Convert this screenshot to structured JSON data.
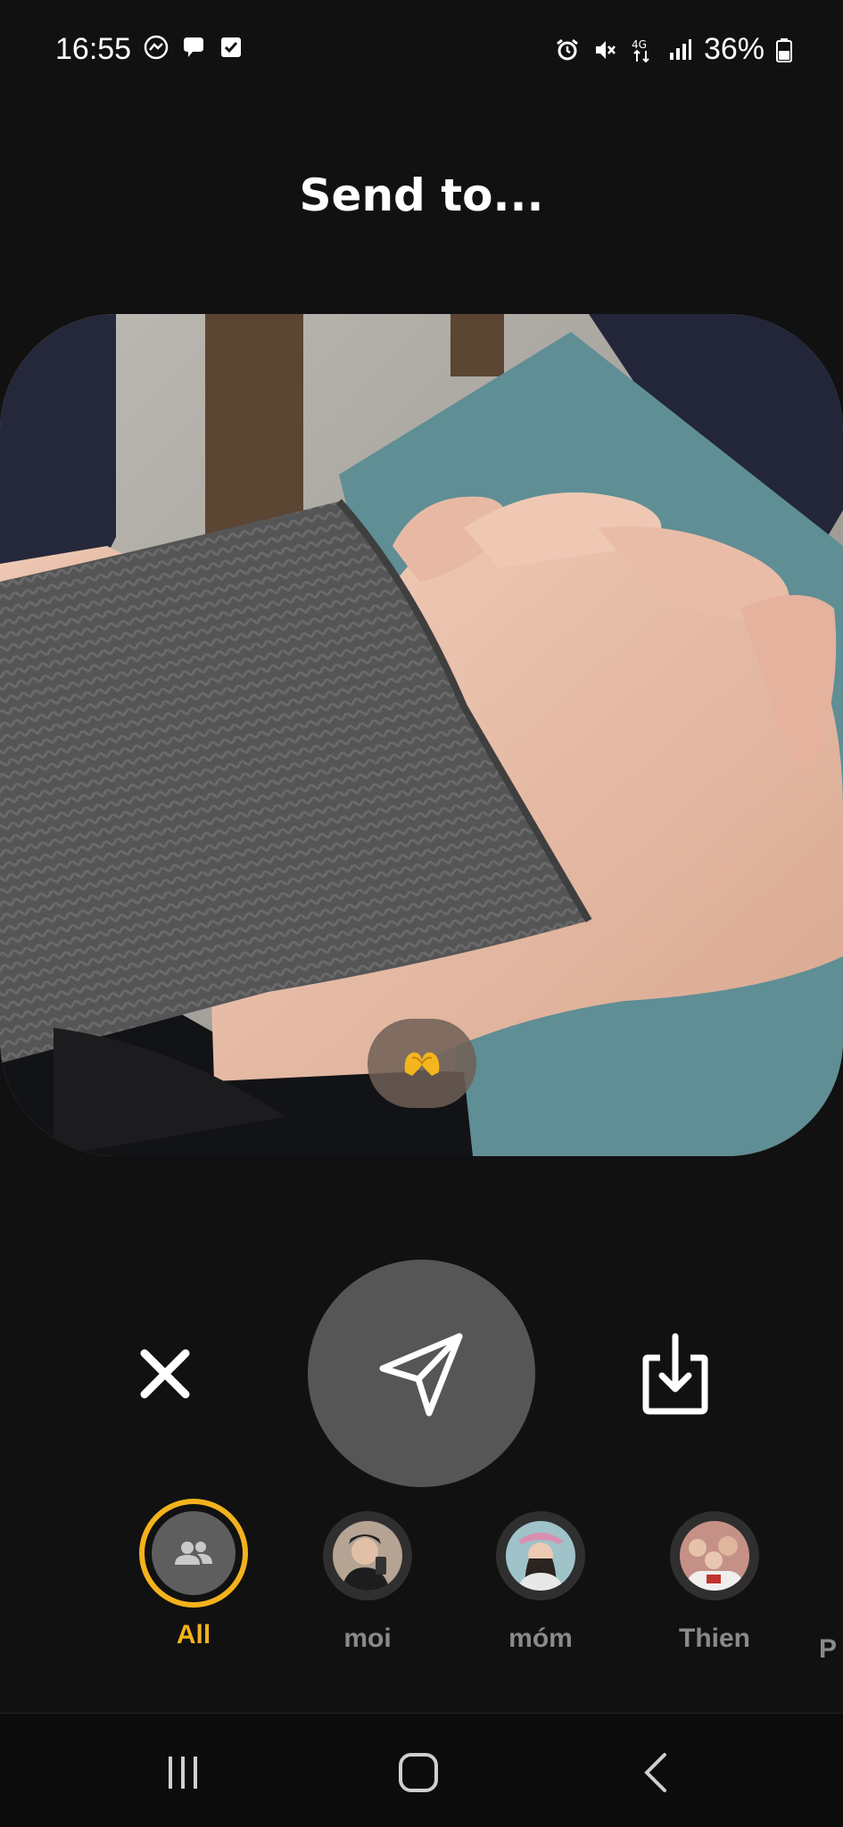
{
  "status_bar": {
    "time": "16:55",
    "battery": "36%",
    "network": "4G",
    "left_icons": [
      "messenger-icon",
      "chat-bubble-icon",
      "checkbox-icon"
    ],
    "right_icons": [
      "alarm-icon",
      "mute-icon",
      "4g-icon",
      "signal-icon",
      "battery-icon"
    ]
  },
  "header": {
    "title": "Send to..."
  },
  "photo": {
    "reaction_emoji": "🫶"
  },
  "actions": {
    "close_icon": "close-icon",
    "send_icon": "send-icon",
    "save_icon": "download-icon"
  },
  "recipients": {
    "items": [
      {
        "label": "All",
        "selected": true,
        "icon": "group-icon"
      },
      {
        "label": "moi",
        "selected": false
      },
      {
        "label": "móm",
        "selected": false
      },
      {
        "label": "Thien",
        "selected": false
      }
    ],
    "partial_label": "P"
  },
  "nav": {
    "icons": [
      "recent-apps-icon",
      "home-icon",
      "back-icon"
    ]
  },
  "colors": {
    "accent": "#f3b21c",
    "background": "#111111",
    "send_button": "#565656"
  }
}
